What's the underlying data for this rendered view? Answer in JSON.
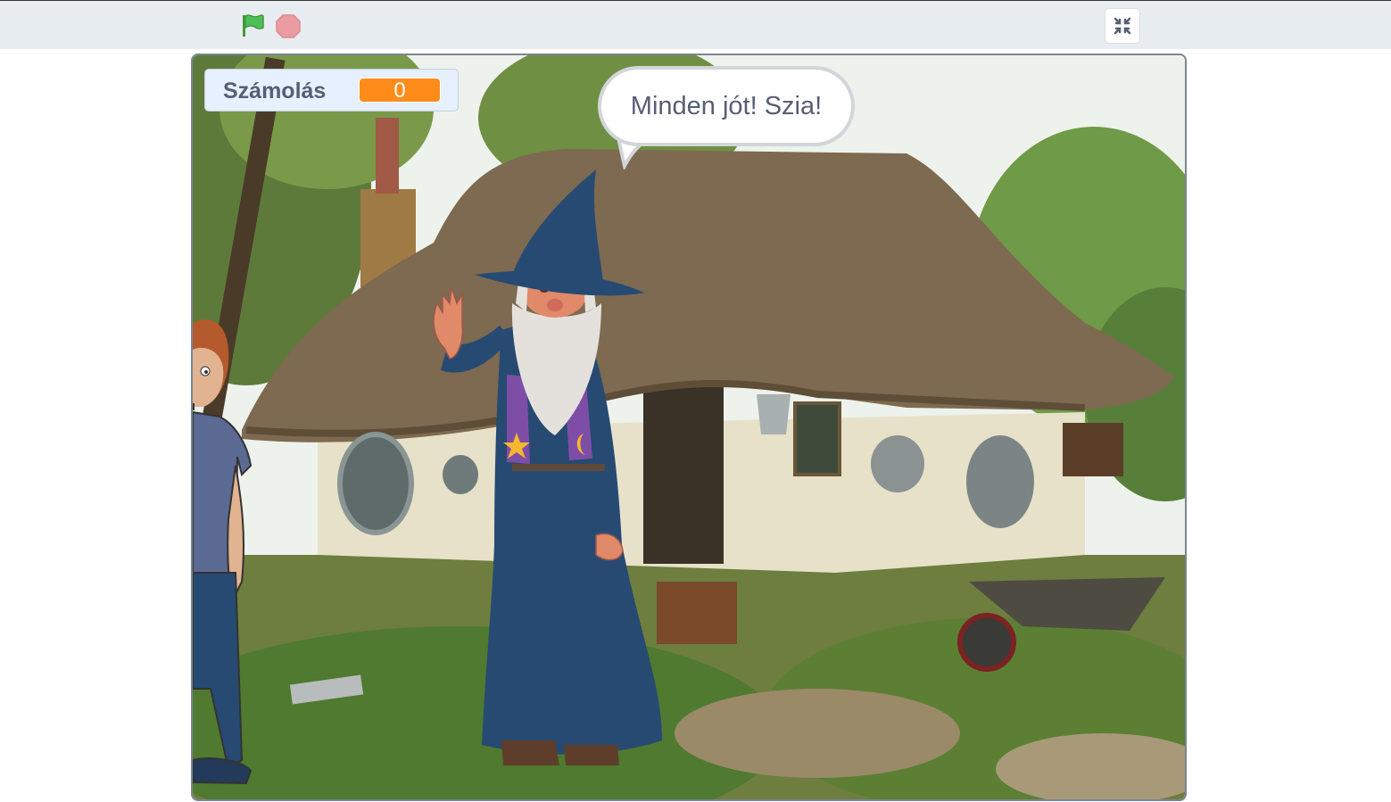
{
  "toolbar": {
    "green_flag_icon": "green-flag-icon",
    "stop_icon": "stop-icon",
    "fullscreen_icon": "exit-fullscreen-icon"
  },
  "monitor": {
    "label": "Számolás",
    "value": "0"
  },
  "speech": {
    "text": "Minden jót! Szia!"
  },
  "colors": {
    "flag": "#4cbf56",
    "stop": "#ec9ca0",
    "monitor_value": "#ff8c1a",
    "wizard_robe": "#274a73",
    "scarf": "#7e4ea6"
  }
}
